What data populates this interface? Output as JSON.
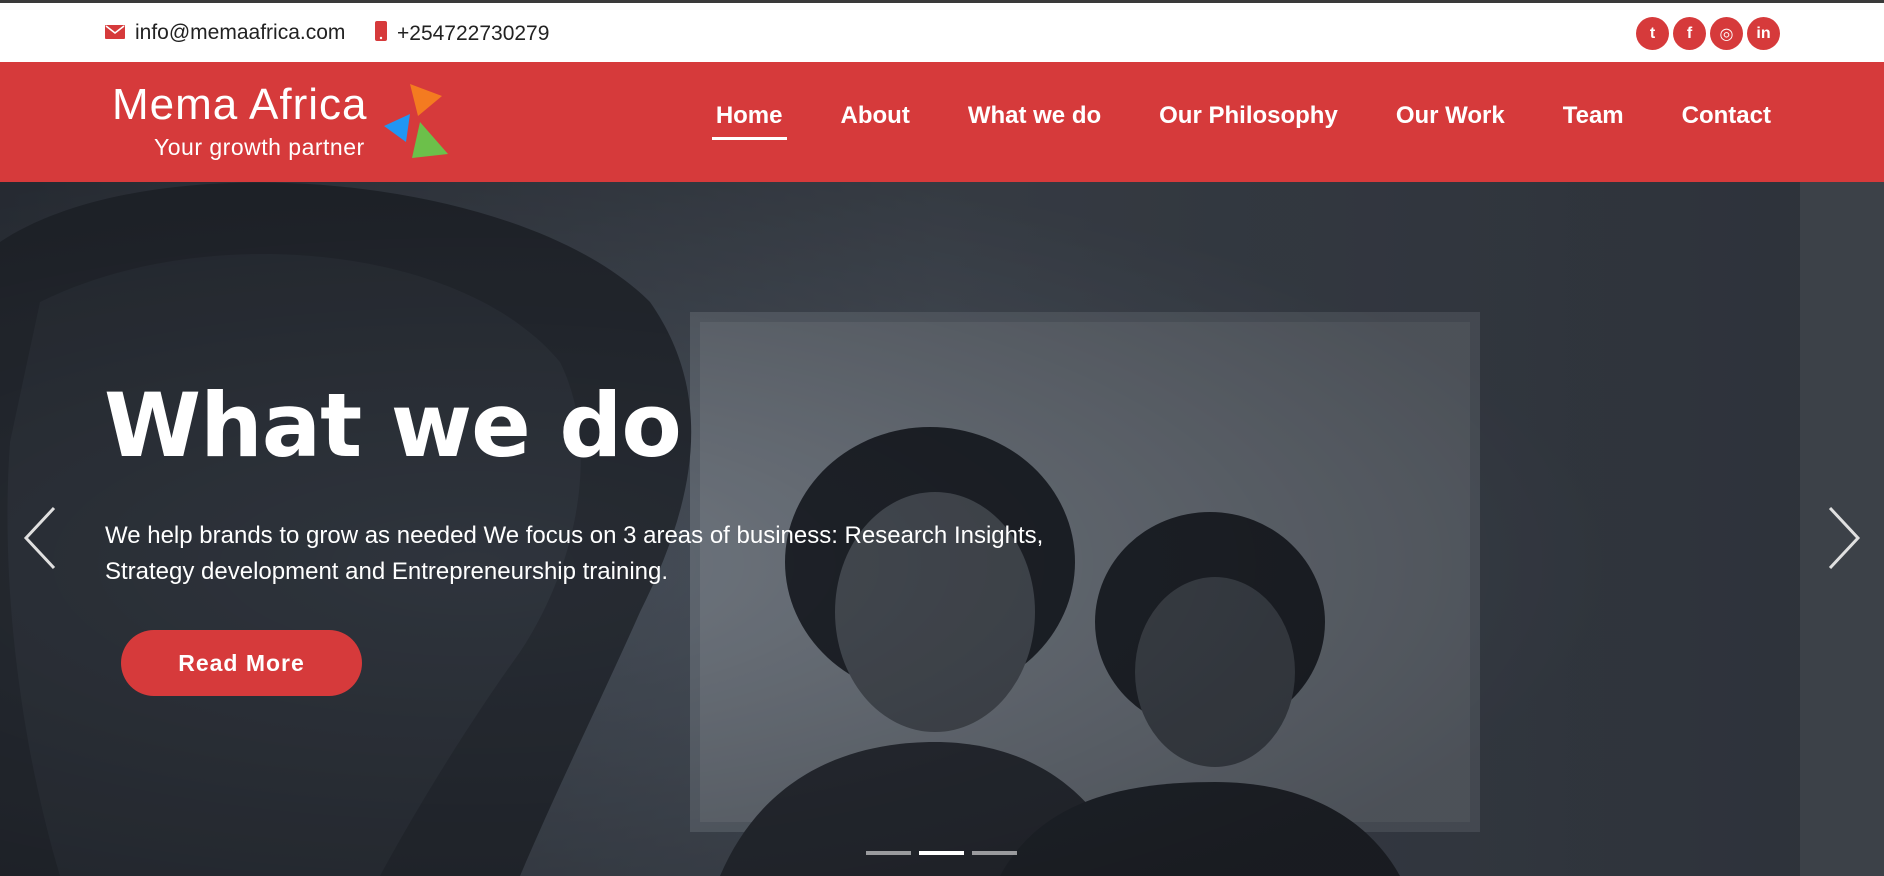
{
  "topbar": {
    "email": "info@memaafrica.com",
    "phone": "+254722730279",
    "email_icon": "envelope-icon",
    "phone_icon": "mobile-phone-icon",
    "socials": [
      {
        "name": "twitter-icon",
        "glyph": "t"
      },
      {
        "name": "facebook-icon",
        "glyph": "f"
      },
      {
        "name": "instagram-icon",
        "glyph": "◎"
      },
      {
        "name": "linkedin-icon",
        "glyph": "in"
      }
    ]
  },
  "brand": {
    "name": "Mema Africa",
    "tagline": "Your growth partner",
    "colors": {
      "primary": "#d63a3b",
      "orange": "#f47b20",
      "blue": "#2196f3",
      "green": "#6cc04a"
    }
  },
  "nav": {
    "items": [
      "Home",
      "About",
      "What we do",
      "Our Philosophy",
      "Our Work",
      "Team",
      "Contact"
    ],
    "active": "Home"
  },
  "hero": {
    "title": "What we do",
    "text": "We help brands to grow as needed We focus on 3 areas of business: Research Insights, Strategy development and Entrepreneurship training.",
    "button": "Read More",
    "prev_icon": "chevron-left-icon",
    "next_icon": "chevron-right-icon",
    "slides_count": 3,
    "active_slide": 2
  }
}
